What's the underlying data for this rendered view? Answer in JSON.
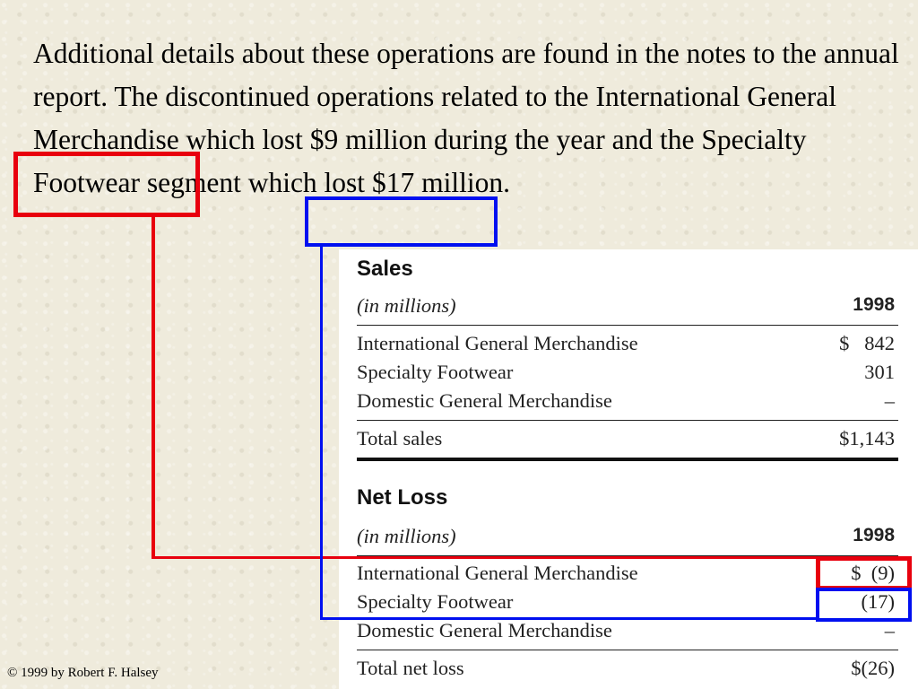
{
  "paragraph": "Additional details about these operations are found in the notes to the annual report. The discontinued operations related to the International General Merchandise which lost $9 million during the year and the Specialty Footwear segment which lost $17 million.",
  "sales": {
    "title": "Sales",
    "subheader": {
      "label": "(in millions)",
      "year": "1998"
    },
    "rows": [
      {
        "label": "International General Merchandise",
        "value": "$   842"
      },
      {
        "label": "Specialty Footwear",
        "value": "301"
      },
      {
        "label": "Domestic General Merchandise",
        "value": "–"
      }
    ],
    "total": {
      "label": "Total sales",
      "value": "$1,143"
    }
  },
  "net_loss": {
    "title": "Net Loss",
    "subheader": {
      "label": "(in millions)",
      "year": "1998"
    },
    "rows": [
      {
        "label": "International General Merchandise",
        "value": "$  (9)"
      },
      {
        "label": "Specialty Footwear",
        "value": "(17)"
      },
      {
        "label": "Domestic General Merchandise",
        "value": "–"
      }
    ],
    "total": {
      "label": "Total net loss",
      "value": "$(26)"
    }
  },
  "highlight_colors": {
    "red": "#e8000e",
    "blue": "#0010f0"
  },
  "footer": "© 1999 by Robert F. Halsey"
}
